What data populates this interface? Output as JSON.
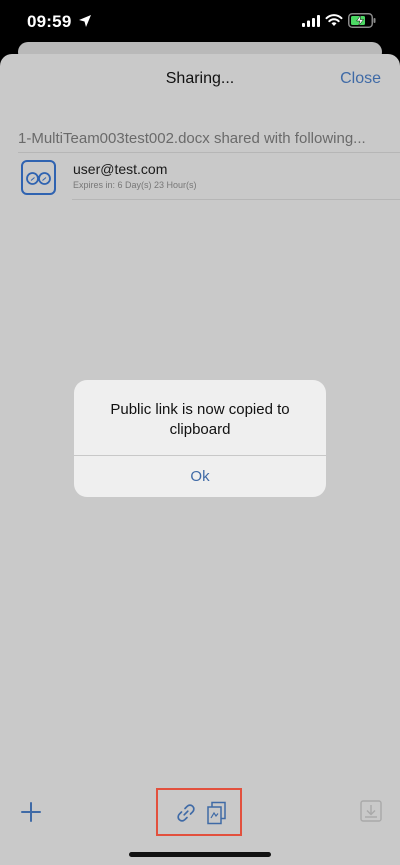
{
  "status_bar": {
    "time": "09:59"
  },
  "nav": {
    "title": "Sharing...",
    "close_label": "Close"
  },
  "share": {
    "header": "1-MultiTeam003test002.docx shared with following...",
    "users": [
      {
        "email": "user@test.com",
        "expires": "Expires in: 6 Day(s) 23 Hour(s)",
        "icon": "glasses-icon"
      }
    ]
  },
  "alert": {
    "message": "Public link is now copied to clipboard",
    "ok_label": "Ok"
  },
  "toolbar": {
    "icons": [
      "plus-icon",
      "link-icon",
      "copy-document-icon",
      "download-icon"
    ]
  },
  "colors": {
    "accent": "#3f6aa6",
    "highlight": "#e2503d",
    "sheet_bg": "#c9c9c9"
  }
}
